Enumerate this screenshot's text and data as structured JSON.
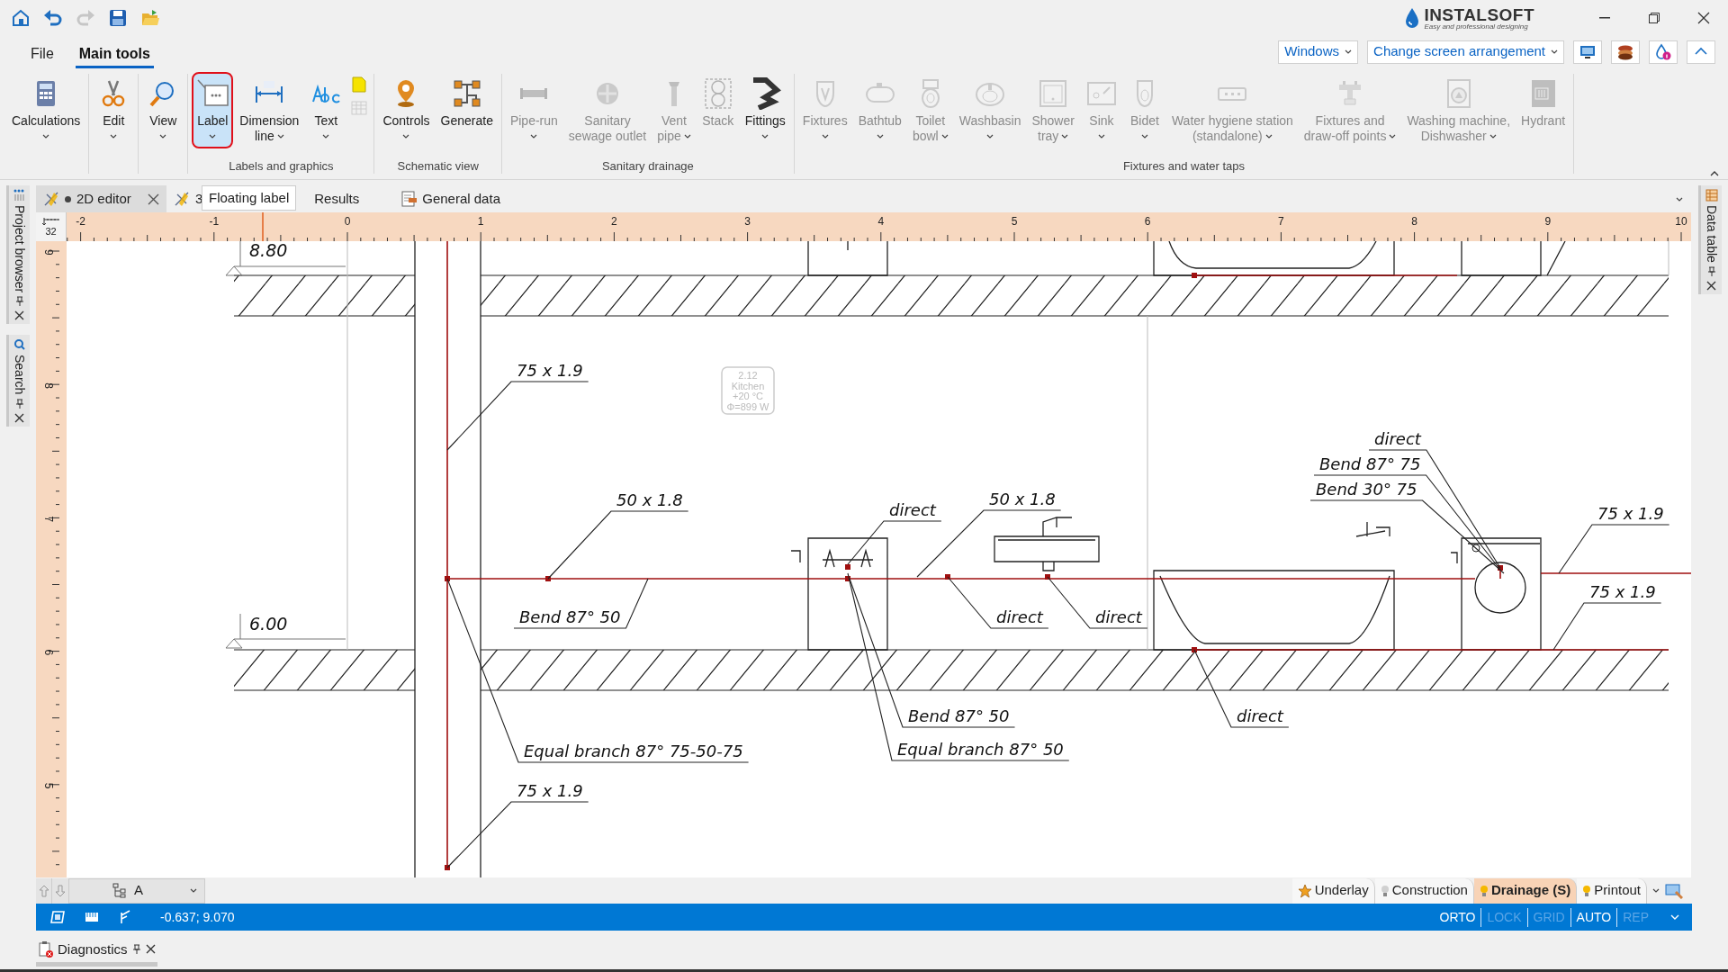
{
  "quick_access": [
    {
      "disabled": false
    },
    {
      "disabled": false
    },
    {
      "disabled": true
    },
    {
      "disabled": false
    },
    {
      "disabled": false
    }
  ],
  "logo": {
    "name": "INSTALSOFT",
    "tagline": "Easy and professional designing"
  },
  "menu_tabs": [
    {
      "label": "File",
      "selected": false
    },
    {
      "label": "Main tools",
      "selected": true
    }
  ],
  "toolbar_dropdowns": [
    "Windows",
    "Change screen arrangement"
  ],
  "ribbon": {
    "groups": [
      {
        "buttons": [
          {
            "kind": "large",
            "lines": [
              "Calculations"
            ],
            "dropdown": true,
            "disabled": false,
            "selected": false
          }
        ]
      },
      {
        "buttons": [
          {
            "kind": "large",
            "lines": [
              "Edit"
            ],
            "dropdown": true,
            "disabled": false,
            "selected": false
          }
        ]
      },
      {
        "buttons": [
          {
            "kind": "large",
            "lines": [
              "View"
            ],
            "dropdown": true,
            "disabled": false,
            "selected": false
          }
        ]
      },
      {
        "label": "Labels and graphics",
        "buttons": [
          {
            "kind": "large",
            "lines": [
              "Label"
            ],
            "dropdown": true,
            "disabled": false,
            "selected": true
          },
          {
            "kind": "large",
            "lines": [
              "Dimension",
              "line"
            ],
            "dropdown": true,
            "disabled": false,
            "selected": false
          },
          {
            "kind": "large",
            "lines": [
              "Text"
            ],
            "dropdown": true,
            "disabled": false,
            "selected": false
          },
          {
            "kind": "mini",
            "items": [
              {
                "disabled": false
              },
              {
                "disabled": true
              }
            ]
          }
        ]
      },
      {
        "label": "Schematic view",
        "buttons": [
          {
            "kind": "large",
            "lines": [
              "Controls"
            ],
            "dropdown": true,
            "disabled": false,
            "selected": false
          },
          {
            "kind": "large",
            "lines": [
              "Generate"
            ],
            "dropdown": false,
            "disabled": false,
            "selected": false
          }
        ]
      },
      {
        "label": "Sanitary drainage",
        "buttons": [
          {
            "kind": "large",
            "lines": [
              "Pipe-run"
            ],
            "dropdown": true,
            "disabled": true,
            "selected": false
          },
          {
            "kind": "large",
            "lines": [
              "Sanitary",
              "sewage outlet"
            ],
            "dropdown": false,
            "disabled": true,
            "selected": false
          },
          {
            "kind": "large",
            "lines": [
              "Vent",
              "pipe"
            ],
            "dropdown": true,
            "disabled": true,
            "selected": false
          },
          {
            "kind": "large",
            "lines": [
              "Stack"
            ],
            "dropdown": false,
            "disabled": true,
            "selected": false
          },
          {
            "kind": "large",
            "lines": [
              "Fittings"
            ],
            "dropdown": true,
            "disabled": false,
            "selected": false
          }
        ]
      },
      {
        "label": "Fixtures and water taps",
        "buttons": [
          {
            "kind": "large",
            "lines": [
              "Fixtures"
            ],
            "dropdown": true,
            "disabled": true,
            "selected": false
          },
          {
            "kind": "large",
            "lines": [
              "Bathtub"
            ],
            "dropdown": true,
            "disabled": true,
            "selected": false
          },
          {
            "kind": "large",
            "lines": [
              "Toilet",
              "bowl"
            ],
            "dropdown": true,
            "disabled": true,
            "selected": false
          },
          {
            "kind": "large",
            "lines": [
              "Washbasin"
            ],
            "dropdown": true,
            "disabled": true,
            "selected": false
          },
          {
            "kind": "large",
            "lines": [
              "Shower",
              "tray"
            ],
            "dropdown": true,
            "disabled": true,
            "selected": false
          },
          {
            "kind": "large",
            "lines": [
              "Sink"
            ],
            "dropdown": true,
            "disabled": true,
            "selected": false
          },
          {
            "kind": "large",
            "lines": [
              "Bidet"
            ],
            "dropdown": true,
            "disabled": true,
            "selected": false
          },
          {
            "kind": "large",
            "lines": [
              "Water hygiene station",
              "(standalone)"
            ],
            "dropdown": true,
            "disabled": true,
            "selected": false
          },
          {
            "kind": "large",
            "lines": [
              "Fixtures and",
              "draw-off points"
            ],
            "dropdown": true,
            "disabled": true,
            "selected": false
          },
          {
            "kind": "large",
            "lines": [
              "Washing machine,",
              "Dishwasher"
            ],
            "dropdown": true,
            "disabled": true,
            "selected": false
          },
          {
            "kind": "large",
            "lines": [
              "Hydrant"
            ],
            "dropdown": false,
            "disabled": true,
            "selected": false
          }
        ]
      }
    ]
  },
  "document_tabs": [
    {
      "label": "2D editor",
      "modified": true,
      "closable": true,
      "selected": true
    },
    {
      "label": "3",
      "modified": false,
      "closable": false,
      "selected": false
    },
    {
      "label": "Results",
      "modified": false,
      "closable": false,
      "selected": false
    },
    {
      "label": "General data",
      "modified": false,
      "closable": false,
      "selected": false
    }
  ],
  "tooltip": "Floating label",
  "side_panels": {
    "left": [
      {
        "label": "Project browser"
      },
      {
        "label": "Search"
      }
    ],
    "right": [
      {
        "label": "Data table"
      }
    ]
  },
  "ruler": {
    "corner": "32",
    "x_labels": [
      "-2",
      "-1",
      "0",
      "1",
      "2",
      "3",
      "4",
      "5",
      "6",
      "7",
      "8",
      "9",
      "10"
    ],
    "y_labels": [
      "9",
      "8",
      "7",
      "6",
      "5"
    ]
  },
  "drawing": {
    "room_tag": [
      "2.12",
      "Kitchen",
      "+20 °C",
      "Φ=899 W"
    ],
    "levels": [
      "8.80",
      "6.00"
    ],
    "labels": [
      "75 x 1.9",
      "50 x 1.8",
      "Bend 87° 50",
      "direct",
      "50 x 1.8",
      "direct",
      "direct",
      "direct",
      "Bend 87° 75",
      "Bend 30° 75",
      "75 x 1.9",
      "75 x 1.9",
      "Bend 87° 50",
      "Equal branch 87° 75-50-75",
      "Equal branch 87° 50",
      "direct",
      "75 x 1.9"
    ]
  },
  "layer_selector": "A",
  "layers": [
    {
      "label": "Underlay",
      "kind": "star",
      "lit": true,
      "selected": false
    },
    {
      "label": "Construction",
      "kind": "bulb",
      "lit": false,
      "selected": false
    },
    {
      "label": "Drainage (S)",
      "kind": "bulb",
      "lit": true,
      "selected": true
    },
    {
      "label": "Printout",
      "kind": "bulb",
      "lit": true,
      "selected": false
    }
  ],
  "status_bar": {
    "coordinates": "-0.637; 9.070",
    "flags": [
      {
        "label": "ORTO",
        "on": true
      },
      {
        "label": "LOCK",
        "on": false
      },
      {
        "label": "GRID",
        "on": false
      },
      {
        "label": "AUTO",
        "on": true
      },
      {
        "label": "REP",
        "on": false
      }
    ]
  },
  "bottom_panel": {
    "label": "Diagnostics"
  }
}
